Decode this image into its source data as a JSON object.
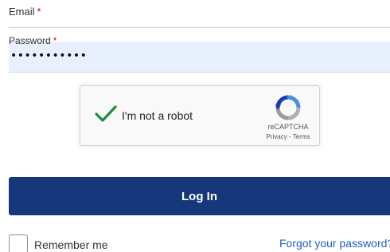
{
  "form": {
    "email_label": "Email",
    "required_mark": "*",
    "password_label": "Password",
    "password_value": "•••••••••••",
    "login_label": "Log In",
    "remember_label": "Remember me",
    "forgot_label": "Forgot your password?"
  },
  "recaptcha": {
    "label": "I'm not a robot",
    "brand": "reCAPTCHA",
    "links": "Privacy - Terms",
    "check_icon": "checkmark-icon",
    "logo_icon": "recaptcha-logo-icon"
  },
  "colors": {
    "accent": "#16377a",
    "required": "#d0021b",
    "autofill": "#e8f0fe",
    "link": "#1f5fbf",
    "check": "#1e8e3e"
  }
}
